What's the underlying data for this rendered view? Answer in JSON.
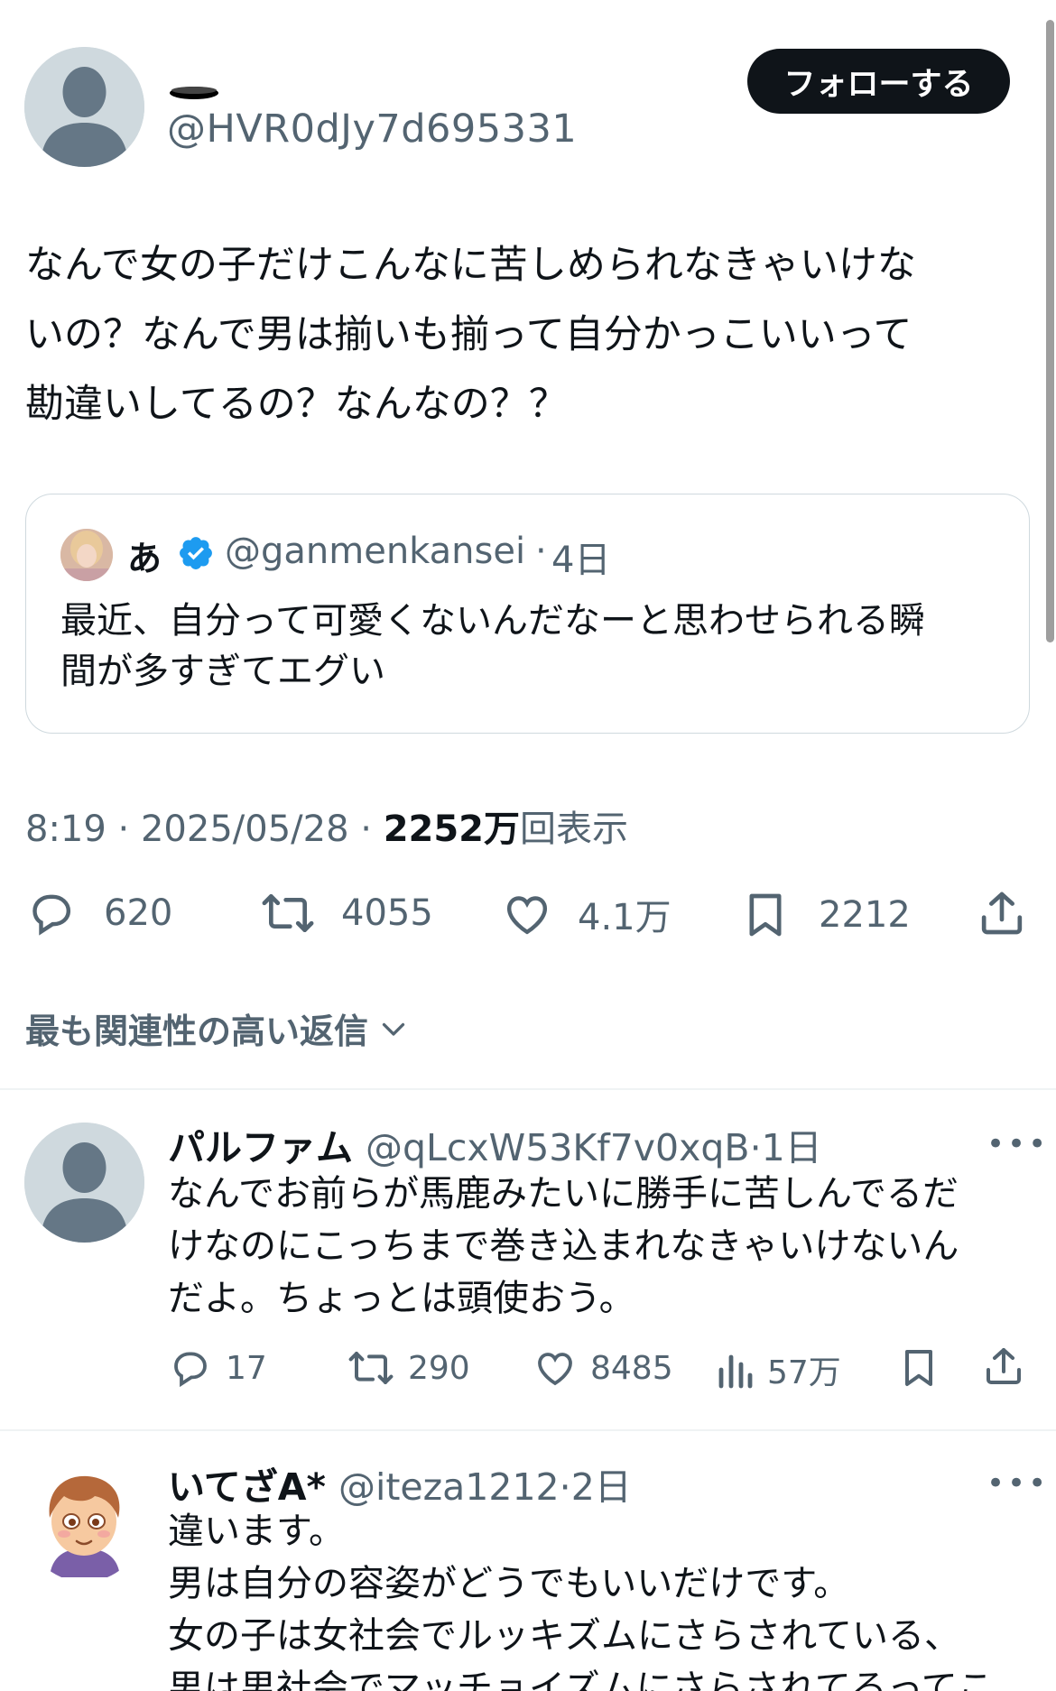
{
  "main_tweet": {
    "handle": "@HVR0dJy7d695331",
    "follow_label": "フォローする",
    "text_lines": [
      "なんで女の子だけこんなに苦しめられなきゃいけな",
      "いの？なんで男は揃いも揃って自分かっこいいって",
      "勘違いしてるの？なんなの？？"
    ],
    "quote": {
      "name": "あ",
      "handle": "@ganmenkansei",
      "separator": "·",
      "time": "4日",
      "text_lines": [
        "最近、自分って可愛くないんだなーと思わせられる瞬",
        "間が多すぎてエグい"
      ]
    },
    "meta": {
      "time": "8:19",
      "sep1": " · ",
      "date": "2025/05/28",
      "sep2": " · ",
      "views_count": "2252万",
      "views_label": "回表示"
    },
    "actions": {
      "replies": "620",
      "reposts": "4055",
      "likes": "4.1万",
      "bookmarks": "2212"
    }
  },
  "sort": {
    "label": "最も関連性の高い返信"
  },
  "replies": [
    {
      "name": "パルファム",
      "handle": "@qLcxW53Kf7v0xqB",
      "separator": "·",
      "time": "1日",
      "more": "•••",
      "text_lines": [
        "なんでお前らが馬鹿みたいに勝手に苦しんでるだ",
        "けなのにこっちまで巻き込まれなきゃいけないん",
        "だよ。ちょっとは頭使おう。"
      ],
      "actions": {
        "replies": "17",
        "reposts": "290",
        "likes": "8485",
        "views": "57万"
      }
    },
    {
      "name": "いてざA*",
      "handle": "@iteza1212",
      "separator": "·",
      "time": "2日",
      "more": "•••",
      "text_lines": [
        "違います。",
        "男は自分の容姿がどうでもいいだけです。",
        "女の子は女社会でルッキズムにさらされている、",
        "男は男社会でマッチョイズムにさらされてるってこ"
      ]
    }
  ],
  "colors": {
    "text": "#0f1419",
    "secondary": "#536471",
    "verified": "#1d9bf0",
    "border": "#cfd9de",
    "avatar_default": "#cfd9de"
  },
  "icons": [
    "reply-icon",
    "repost-icon",
    "like-icon",
    "bookmark-icon",
    "share-icon",
    "views-icon",
    "chevron-down-icon",
    "verified-badge-icon",
    "more-icon"
  ]
}
